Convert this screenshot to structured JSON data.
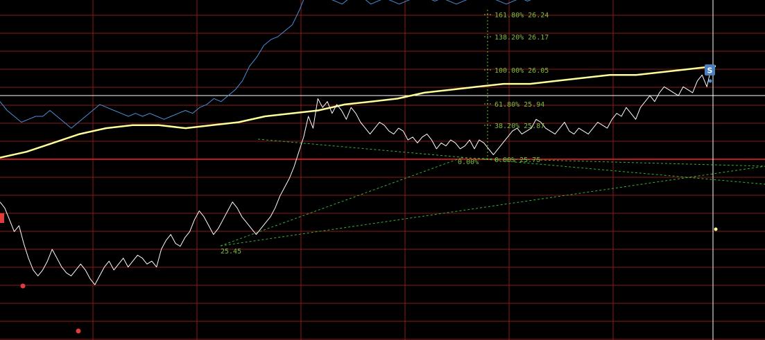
{
  "chart_data": {
    "type": "line",
    "title": "",
    "xlabel": "",
    "ylabel": "",
    "ylim": [
      25.33,
      26.32
    ],
    "grid": true,
    "colors": {
      "background": "#000000",
      "grid": "#8b1a1a",
      "price_line": "#ffffff",
      "secondary_line": "#4a90d9",
      "average_line": "#ffff99",
      "fib_lines": "#7fbf3f",
      "trend_lines": "#38b438",
      "crosshair": "#ffffff",
      "markers": "#e03c3c",
      "s_marker": "#4a7fc0"
    },
    "series": [
      {
        "role": "price",
        "values": [
          25.61,
          25.59,
          25.55,
          25.51,
          25.53,
          25.47,
          25.42,
          25.38,
          25.36,
          25.38,
          25.41,
          25.45,
          25.42,
          25.39,
          25.37,
          25.36,
          25.38,
          25.4,
          25.38,
          25.35,
          25.33,
          25.36,
          25.39,
          25.41,
          25.38,
          25.4,
          25.42,
          25.39,
          25.41,
          25.43,
          25.42,
          25.4,
          25.41,
          25.39,
          25.45,
          25.48,
          25.5,
          25.47,
          25.46,
          25.49,
          25.51,
          25.55,
          25.58,
          25.56,
          25.53,
          25.5,
          25.52,
          25.55,
          25.58,
          25.61,
          25.59,
          25.56,
          25.54,
          25.52,
          25.5,
          25.52,
          25.54,
          25.56,
          25.59,
          25.63,
          25.66,
          25.69,
          25.73,
          25.78,
          25.83,
          25.9,
          25.86,
          25.96,
          25.93,
          25.95,
          25.91,
          25.94,
          25.92,
          25.89,
          25.93,
          25.91,
          25.88,
          25.86,
          25.84,
          25.86,
          25.88,
          25.87,
          25.85,
          25.84,
          25.86,
          25.85,
          25.82,
          25.83,
          25.81,
          25.83,
          25.84,
          25.82,
          25.79,
          25.81,
          25.8,
          25.82,
          25.81,
          25.79,
          25.8,
          25.82,
          25.79,
          25.82,
          25.81,
          25.79,
          25.77,
          25.79,
          25.81,
          25.83,
          25.85,
          25.86,
          25.84,
          25.85,
          25.86,
          25.89,
          25.88,
          25.86,
          25.85,
          25.84,
          25.86,
          25.88,
          25.85,
          25.84,
          25.86,
          25.85,
          25.84,
          25.86,
          25.88,
          25.87,
          25.86,
          25.89,
          25.91,
          25.9,
          25.93,
          25.91,
          25.89,
          25.93,
          25.95,
          25.97,
          25.95,
          25.98,
          26.0,
          25.99,
          25.98,
          25.97,
          26.0,
          25.99,
          25.98,
          26.02,
          26.04,
          26.0,
          26.07
        ]
      },
      {
        "role": "secondary",
        "values": [
          25.95,
          25.92,
          25.9,
          25.88,
          25.89,
          25.9,
          25.9,
          25.92,
          25.9,
          25.88,
          25.86,
          25.88,
          25.9,
          25.92,
          25.94,
          25.93,
          25.92,
          25.91,
          25.9,
          25.91,
          25.9,
          25.91,
          25.9,
          25.89,
          25.9,
          25.91,
          25.92,
          25.91,
          25.93,
          25.94,
          25.96,
          25.95,
          25.97,
          25.99,
          26.02,
          26.07,
          26.1,
          26.14,
          26.16,
          26.17,
          26.19,
          26.21,
          26.26,
          26.32,
          26.3,
          26.31,
          26.3,
          26.29,
          26.28,
          26.3,
          26.31,
          26.3,
          26.28,
          26.29,
          26.3,
          26.29,
          26.28,
          26.29,
          26.3,
          26.31,
          26.3,
          26.29,
          26.3,
          26.29,
          26.28,
          26.29,
          26.3,
          26.3,
          26.31,
          26.3,
          26.29,
          26.28,
          26.29,
          26.3,
          26.29,
          26.3,
          26.31,
          26.33,
          26.35,
          26.34,
          26.36,
          26.37,
          26.39,
          26.36,
          26.35,
          26.38,
          26.37,
          26.36,
          26.36,
          26.37,
          26.39,
          26.38,
          26.37,
          26.36,
          26.37,
          26.38,
          26.39,
          26.41,
          26.43,
          26.44,
          26.45
        ]
      },
      {
        "role": "average",
        "values": [
          25.76,
          25.78,
          25.81,
          25.84,
          25.86,
          25.87,
          25.87,
          25.86,
          25.87,
          25.88,
          25.9,
          25.91,
          25.92,
          25.94,
          25.95,
          25.96,
          25.98,
          25.99,
          26.0,
          26.01,
          26.01,
          26.02,
          26.03,
          26.04,
          26.04,
          26.05,
          26.06,
          26.07
        ]
      }
    ],
    "annotations": {
      "fibonacci": [
        {
          "percent": "161.80%",
          "value": "26.24"
        },
        {
          "percent": "138.20%",
          "value": "26.17"
        },
        {
          "percent": "100.00%",
          "value": "26.05"
        },
        {
          "percent": "61.80%",
          "value": "25.94"
        },
        {
          "percent": "38.20%",
          "value": "25.87"
        },
        {
          "percent": "0.00%",
          "value": "25.75"
        }
      ],
      "low_label": "25.45",
      "mid_label": "0.00%",
      "s_marker_label": "S",
      "left_marker_label": ""
    }
  }
}
